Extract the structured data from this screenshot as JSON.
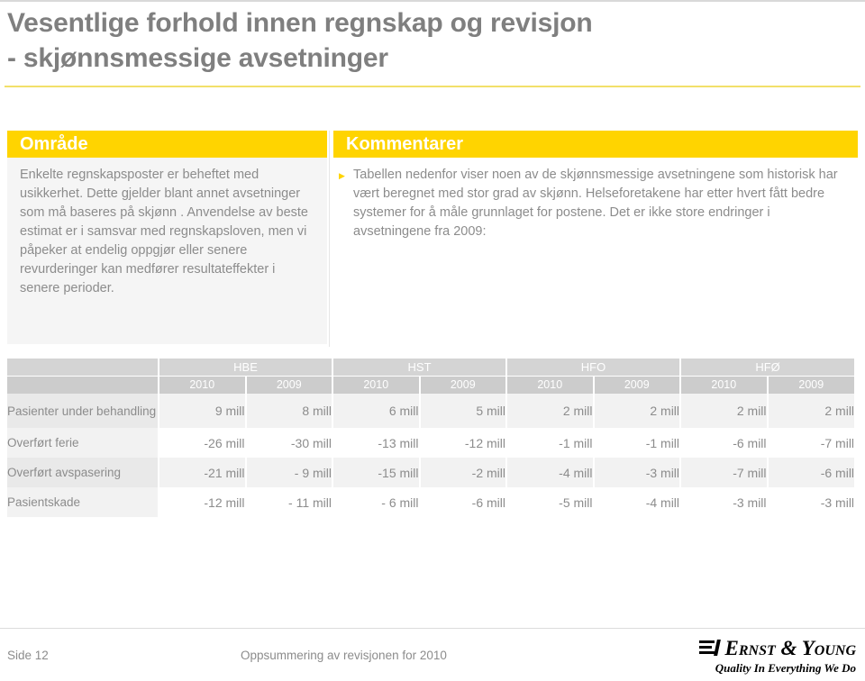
{
  "slide": {
    "title_line1": "Vesentlige forhold innen regnskap og revisjon",
    "title_line2": "- skjønnsmessige avsetninger",
    "accent_yellow": "#ffd400",
    "rule_yellow": "#f2e06a",
    "text_gray": "#8c8c8c"
  },
  "panels": {
    "left": {
      "heading": "Område",
      "body": "Enkelte regnskapsposter er beheftet med usikkerhet.  Dette gjelder blant annet avsetninger som må baseres på skjønn . Anvendelse av beste estimat er i samsvar med regnskapsloven, men vi påpeker at endelig oppgjør eller senere revurderinger kan medfører resultateffekter i senere perioder."
    },
    "right": {
      "heading": "Kommentarer",
      "bullet_icon": "triangle-right-icon",
      "bullet_text": "Tabellen nedenfor viser noen av de skjønnsmessige avsetningene som historisk har vært beregnet med stor grad av skjønn. Helseforetakene har etter hvert fått bedre systemer for å måle grunnlaget for postene. Det er ikke store endringer i avsetningene fra 2009:"
    }
  },
  "table": {
    "corner_label": "",
    "groups": [
      "HBE",
      "HST",
      "HFO",
      "HFØ"
    ],
    "years": [
      "2010",
      "2009",
      "2010",
      "2009",
      "2010",
      "2009",
      "2010",
      "2009"
    ],
    "rows": [
      {
        "label": "Pasienter under behandling",
        "values": [
          "9 mill",
          "8 mill",
          "6 mill",
          "5 mill",
          "2 mill",
          "2 mill",
          "2 mill",
          "2 mill"
        ]
      },
      {
        "label": "Overført ferie",
        "values": [
          "-26 mill",
          "-30 mill",
          "-13 mill",
          "-12 mill",
          "-1 mill",
          "-1 mill",
          "-6 mill",
          "-7 mill"
        ]
      },
      {
        "label": "Overført avspasering",
        "values": [
          "-21 mill",
          "- 9 mill",
          "-15 mill",
          "-2 mill",
          "-4 mill",
          "-3 mill",
          "-7 mill",
          "-6 mill"
        ]
      },
      {
        "label": "Pasientskade",
        "values": [
          "-12 mill",
          "- 11 mill",
          "- 6 mill",
          "-6 mill",
          "-5 mill",
          "-4 mill",
          "-3 mill",
          "-3 mill"
        ]
      }
    ]
  },
  "footer": {
    "page_label": "Side 12",
    "center_label": "Oppsummering av revisjonen for 2010",
    "logo_name": "Ernst & Young",
    "logo_tagline": "Quality In Everything We Do",
    "logo_mark_icon": "ey-beam-icon"
  }
}
